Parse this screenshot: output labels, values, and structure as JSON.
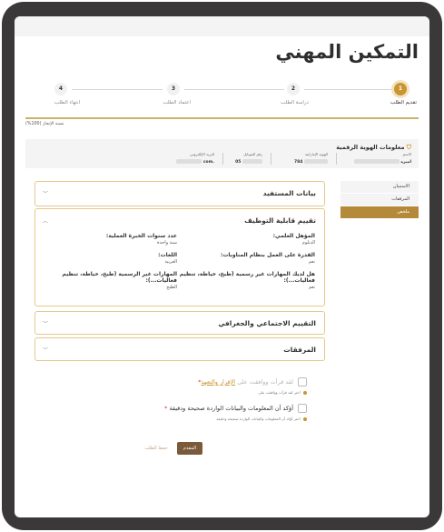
{
  "page": {
    "title": "التمكين المهني"
  },
  "stepper": {
    "steps": [
      {
        "number": "1",
        "label": "تقديم الطلب"
      },
      {
        "number": "2",
        "label": "دراسة الطلب"
      },
      {
        "number": "3",
        "label": "اعتماد الطلب"
      },
      {
        "number": "4",
        "label": "انتهاء الطلب"
      }
    ],
    "progress_label": "نسبة الإنجاز (100%)",
    "progress": 1.0
  },
  "identity": {
    "title": "معلومات الهوية الرقمية",
    "name_label": "الاسم",
    "name_value": "اميره",
    "id_label": "الهوية الإماراتية",
    "id_value": "784",
    "phone_label": "رقم الموبايل",
    "phone_value": "05",
    "email_label": "البريد الإلكتروني",
    "email_value": ".com"
  },
  "sidebar": {
    "items": [
      {
        "label": "الاستبيان"
      },
      {
        "label": "المرفقات"
      },
      {
        "label": "ملخص"
      }
    ]
  },
  "sections": {
    "beneficiary": "بيانات المستفيد",
    "employability": "تقييم قابلية التوظيف",
    "social": "التقييم الاجتماعي والجغرافي",
    "attachments": "المرفقات"
  },
  "employability": {
    "qualification_label": "المؤهل العلمي:",
    "qualification_value": "الدبلوم",
    "experience_label": "عدد سنوات الخبرة العملية:",
    "experience_value": "سنة واحدة",
    "shifts_label": "القدرة على العمل بنظام المناوبات:",
    "shifts_value": "نعم",
    "languages_label": "اللغات:",
    "languages_value": "العربية",
    "informal_q_label": "هل لديك المهارات غير رسمية (طبخ، خياطة، تنظيم فعاليات...):",
    "informal_q_value": "نعم",
    "informal_skills_label": "المهارات غير الرسمية (طبخ، خياطة، تنظيم فعاليات...):",
    "informal_skills_value": "الطبخ"
  },
  "consent": {
    "declaration_prefix": "لقد قرأت ووافقت على",
    "declaration_link": "الإقرار والتعهد",
    "declaration_hint": "اختر لقد قرأت ووافقت على",
    "accuracy_text": "أؤكد أن المعلومات والبيانات الواردة صحيحة ودقيقة",
    "accuracy_hint": "اختر أؤكد أن المعلومات والبيانات الواردة صحيحة ودقيقة",
    "required_mark": "*"
  },
  "actions": {
    "submit_label": "المقدم",
    "save_label": "حفظ الطلب"
  },
  "colors": {
    "accent": "#c9962f",
    "active_sidebar": "#b5893a",
    "submit_button": "#7a5a3a",
    "accordion_border": "#e6c88a"
  }
}
